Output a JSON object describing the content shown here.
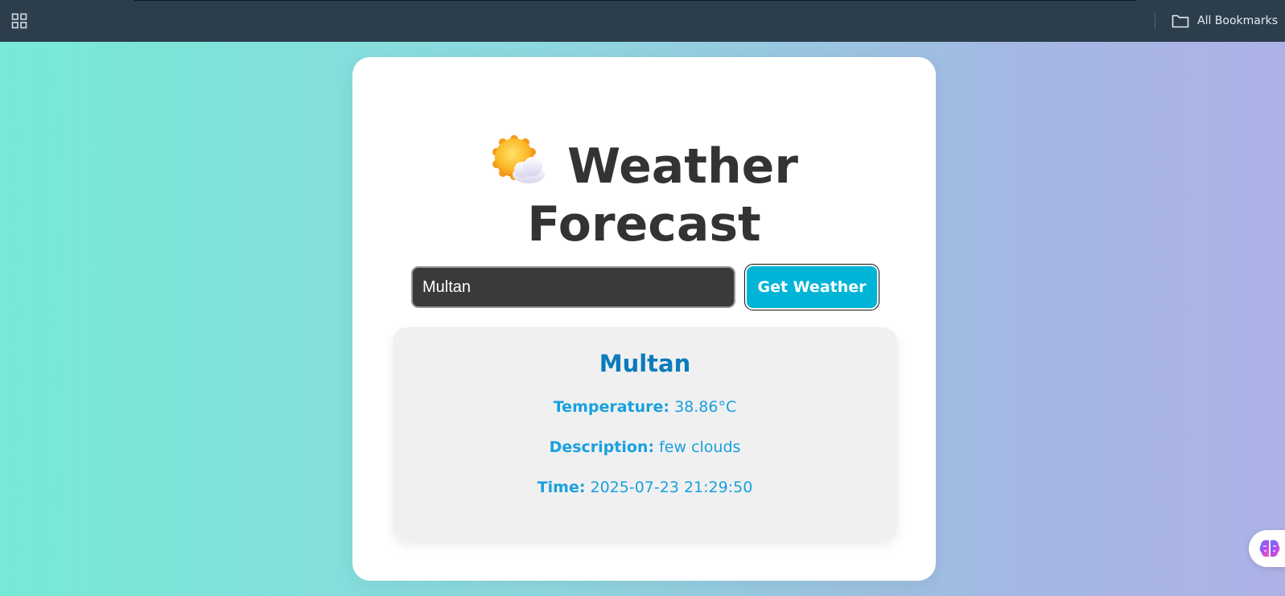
{
  "browser": {
    "bookmarks_label": "All Bookmarks"
  },
  "app": {
    "title_line1": "Weather",
    "title_line2": "Forecast",
    "title_emoji": "sun-behind-cloud-icon"
  },
  "search": {
    "value": "Multan",
    "button_label": "Get Weather"
  },
  "result": {
    "city": "Multan",
    "temperature_label": "Temperature:",
    "temperature_value": "38.86°C",
    "description_label": "Description:",
    "description_value": "few clouds",
    "time_label": "Time:",
    "time_value": "2025-07-23 21:29:50"
  },
  "colors": {
    "accent": "#00b4d8",
    "city_heading": "#0a7bbd",
    "detail_text": "#18a0e0",
    "topbar": "#2c3e4c"
  }
}
